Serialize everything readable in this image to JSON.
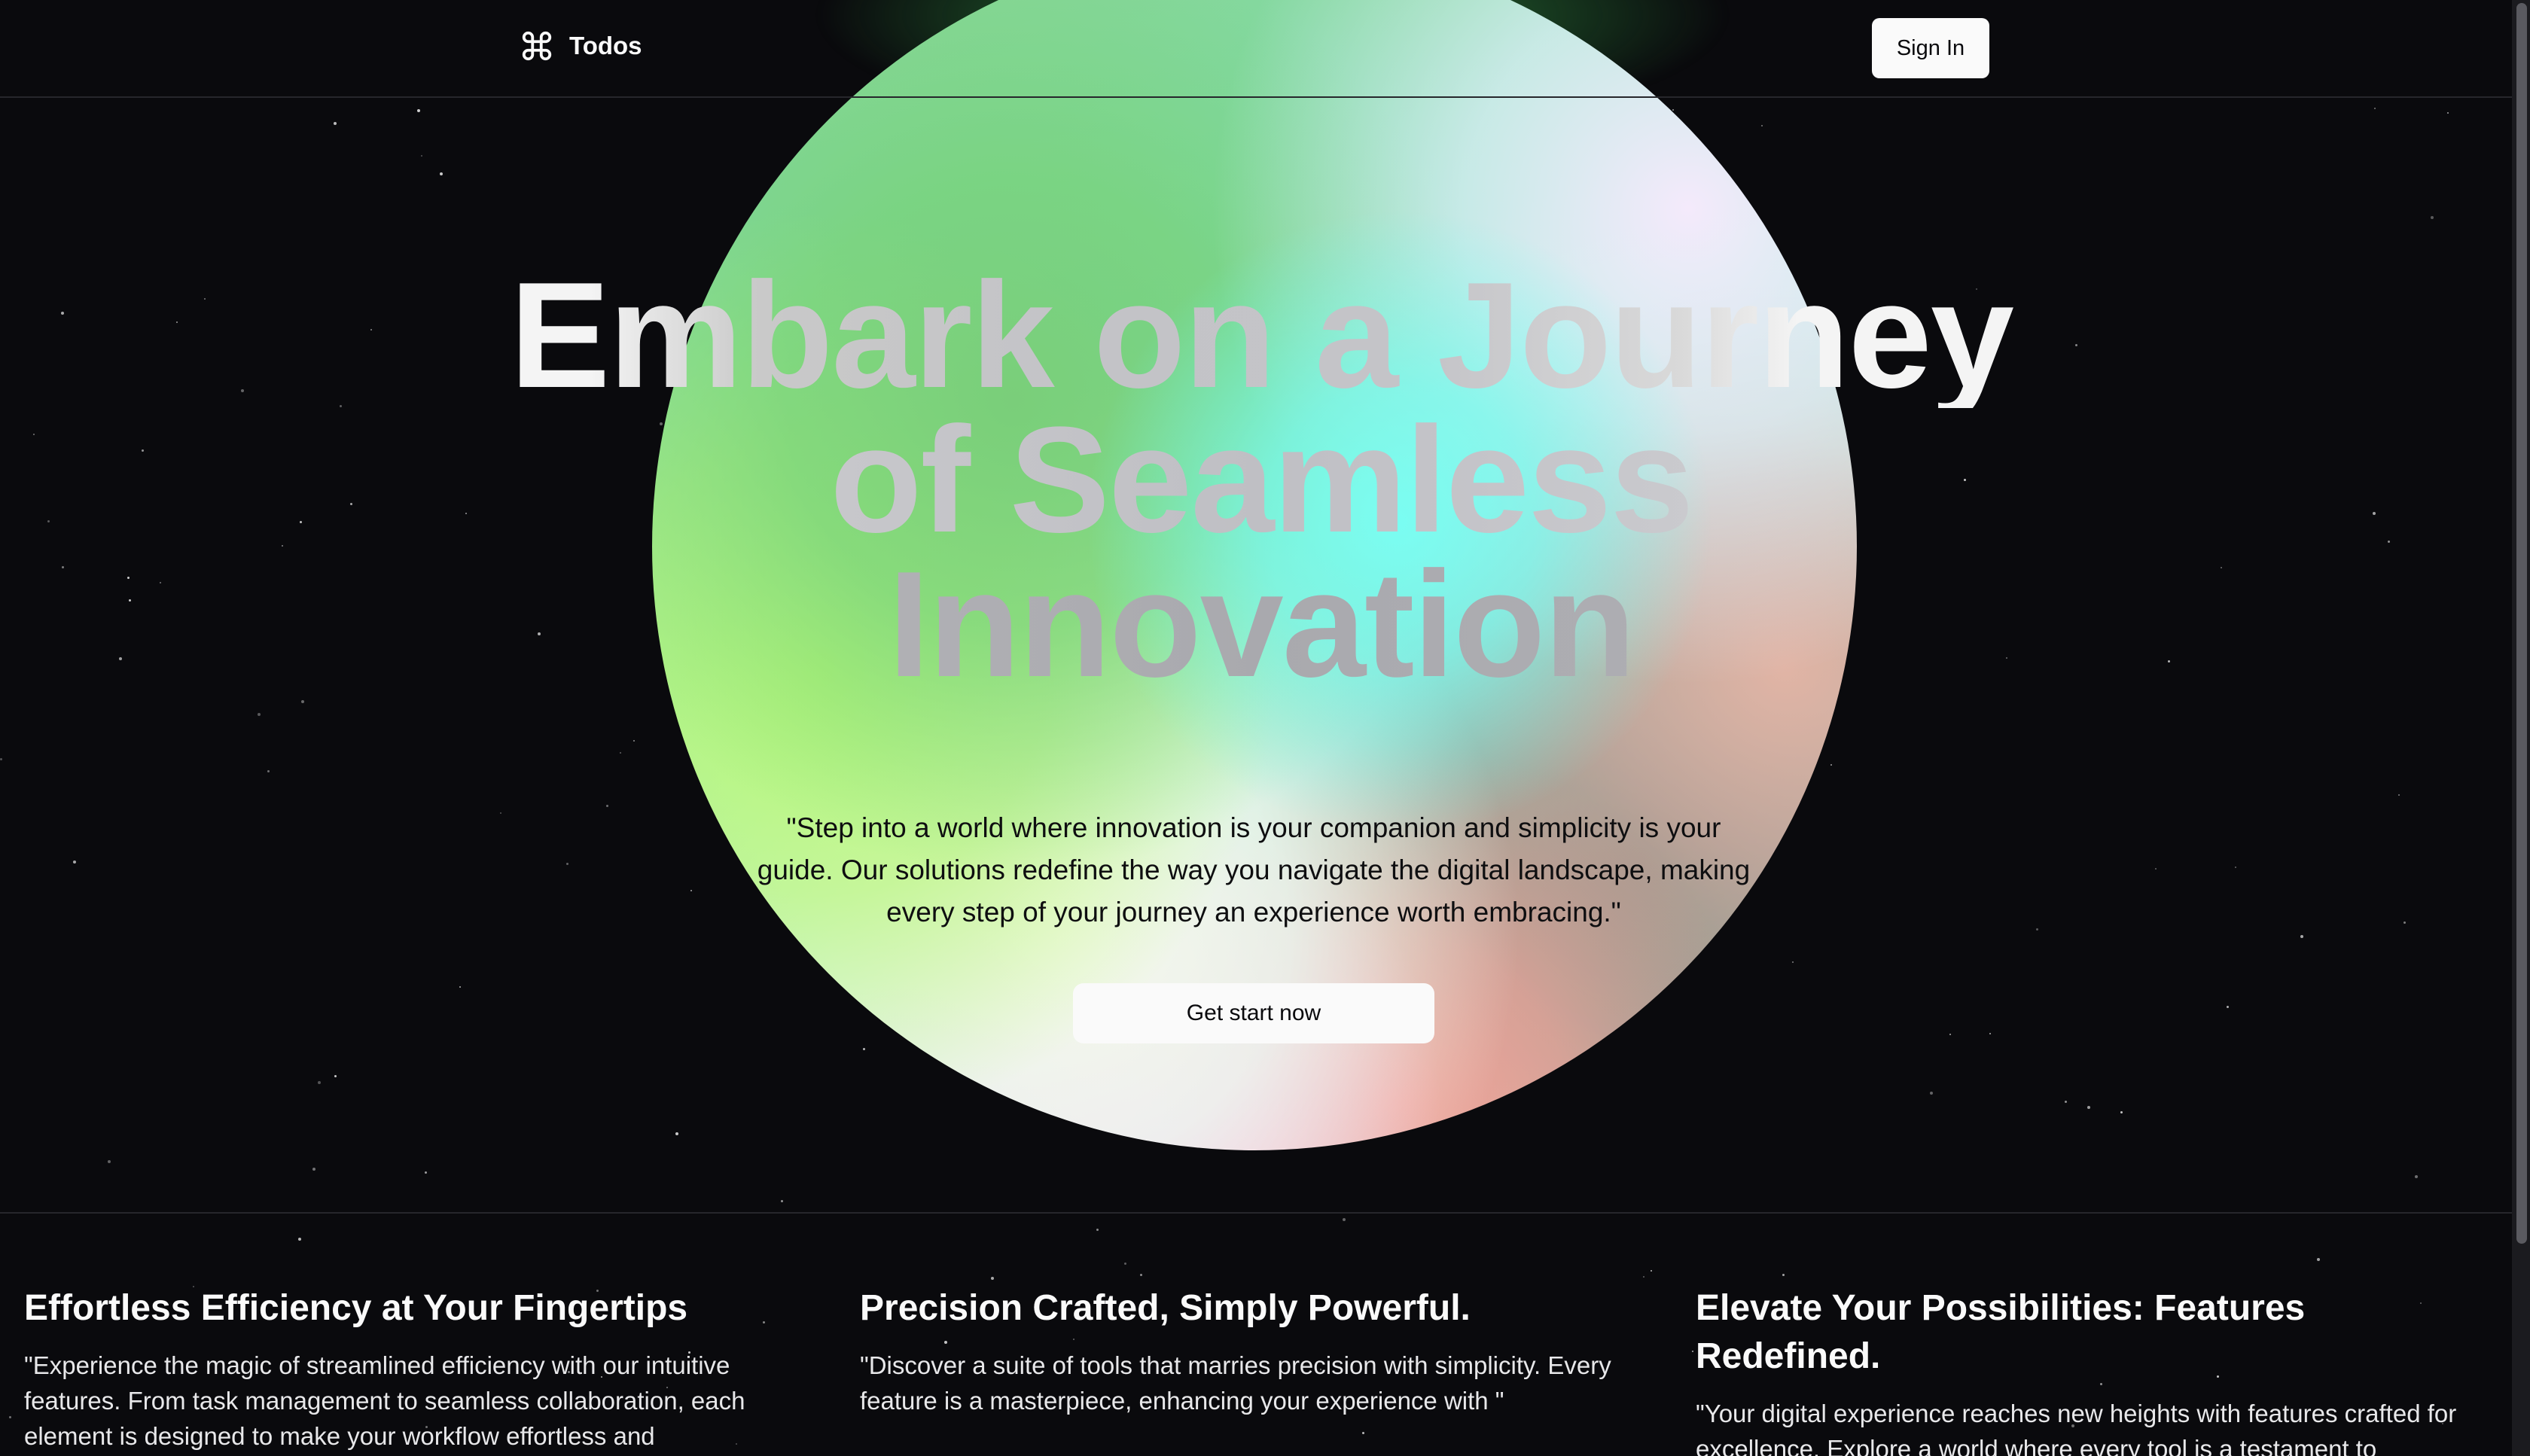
{
  "header": {
    "brand_name": "Todos",
    "brand_icon": "command-icon",
    "signin_label": "Sign In"
  },
  "hero": {
    "title_line1": "Embark on a Journey",
    "title_line2": "of Seamless",
    "title_line3": "Innovation",
    "subtitle": "\"Step into a world where innovation is your companion and simplicity is your guide. Our solutions redefine the way you navigate the digital landscape, making every step of your journey an experience worth embracing.\"",
    "cta_label": "Get start now"
  },
  "features": [
    {
      "title": "Effortless Efficiency at Your Fingertips",
      "text": "\"Experience the magic of streamlined efficiency with our intuitive features. From task management to seamless collaboration, each element is designed to make your workflow effortless and"
    },
    {
      "title": "Precision Crafted, Simply Powerful.",
      "text": "\"Discover a suite of tools that marries precision with simplicity. Every feature is a masterpiece, enhancing your experience with \""
    },
    {
      "title": "Elevate Your Possibilities: Features Redefined.",
      "text": "\"Your digital experience reaches new heights with features crafted for excellence. Explore a world where every tool is a testament to"
    }
  ],
  "colors": {
    "background": "#0a0a0d",
    "button_bg": "#fafafa",
    "text_primary": "#fafafa"
  }
}
